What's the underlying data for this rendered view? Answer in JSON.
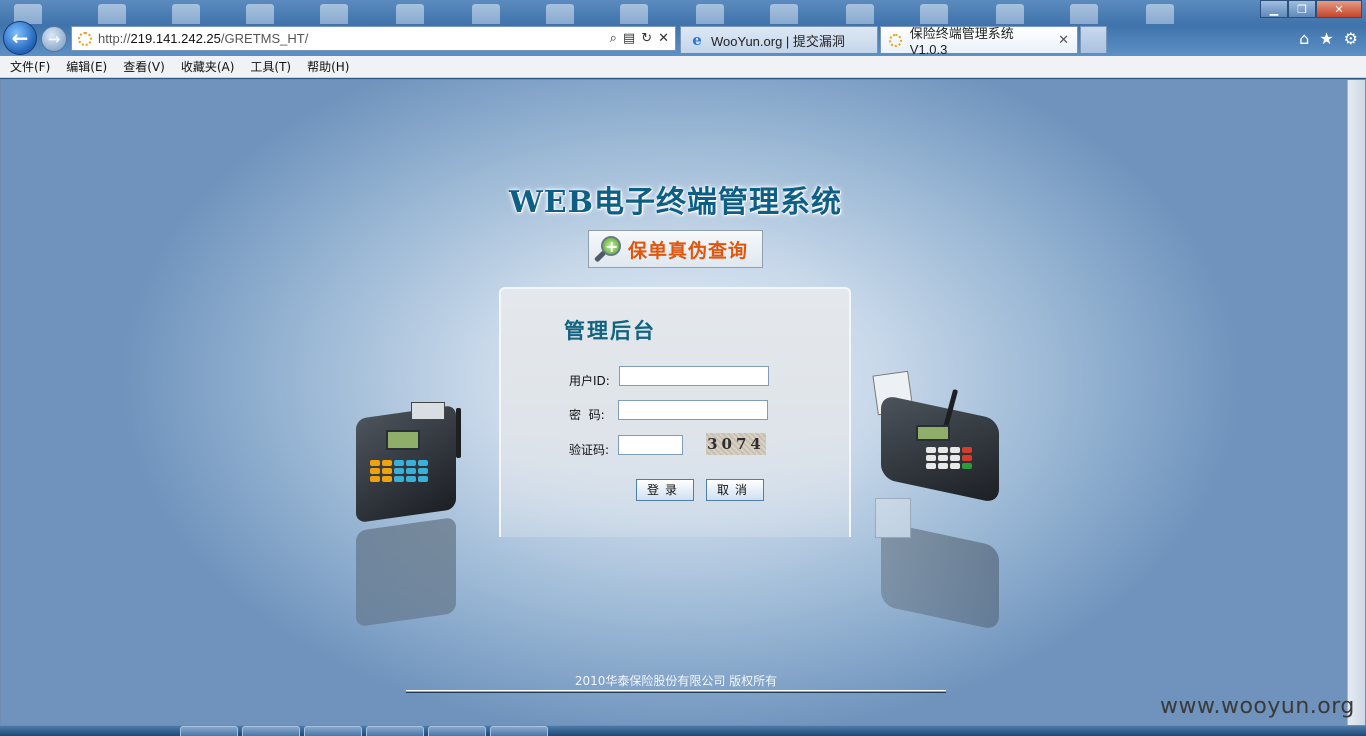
{
  "browser": {
    "address_url_prefix": "http://",
    "address_url_host": "219.141.242.25",
    "address_url_path": "/GRETMS_HT/",
    "tabs": [
      {
        "label": "WooYun.org | 提交漏洞",
        "icon": "ie-icon",
        "active": false
      },
      {
        "label": "保险终端管理系统V1.0.3",
        "icon": "loading-icon",
        "active": true
      }
    ],
    "window_buttons": {
      "minimize": "▁",
      "restore": "❐",
      "close": "✕"
    },
    "chrome_icons": {
      "home": "⌂",
      "favorites": "★",
      "tools": "⚙"
    }
  },
  "menu": {
    "items": [
      "文件(F)",
      "编辑(E)",
      "查看(V)",
      "收藏夹(A)",
      "工具(T)",
      "帮助(H)"
    ]
  },
  "page": {
    "title": "WEB电子终端管理系统",
    "verify_link": "保单真伪查询",
    "login": {
      "heading": "管理后台",
      "user_label": "用户ID:",
      "password_label": "密  码:",
      "captcha_label": "验证码:",
      "captcha_value": "3074",
      "user_value": "",
      "password_value": "",
      "captcha_input_value": "",
      "login_button": "登录",
      "cancel_button": "取消"
    },
    "footer": "2010华泰保险股份有限公司 版权所有"
  },
  "watermark": "www.wooyun.org",
  "colors": {
    "title": "#0e5f86",
    "verify_text": "#e0560d",
    "heading": "#12637f"
  }
}
